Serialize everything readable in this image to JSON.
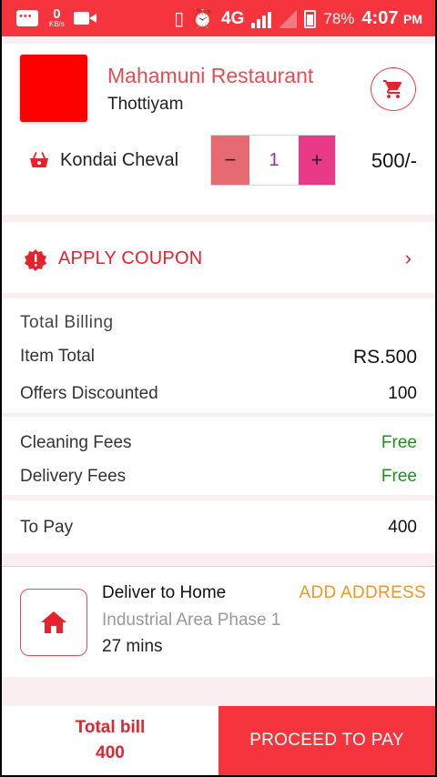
{
  "status_bar": {
    "net_speed_value": "0",
    "net_speed_unit": "KB/s",
    "network_type": "4G",
    "battery_percent": "78%",
    "time": "4:07",
    "time_suffix": "PM"
  },
  "restaurant": {
    "name": "Mahamuni Restaurant",
    "location": "Thottiyam"
  },
  "item": {
    "name": "Kondai Cheval",
    "minus_label": "−",
    "quantity": "1",
    "plus_label": "+",
    "price": "500/-"
  },
  "coupon": {
    "label": "APPLY COUPON",
    "chevron": "›"
  },
  "billing": {
    "title": "Total Billing",
    "item_total_label": "Item Total",
    "item_total_value": "RS.500",
    "offers_label": "Offers Discounted",
    "offers_value": "100"
  },
  "fees": {
    "cleaning_label": "Cleaning Fees",
    "cleaning_value": "Free",
    "delivery_label": "Delivery Fees",
    "delivery_value": "Free"
  },
  "to_pay": {
    "label": "To Pay",
    "value": "400"
  },
  "delivery": {
    "title": "Deliver to Home",
    "address": "Industrial Area Phase 1",
    "eta": "27 mins",
    "add_address_label": "ADD ADDRESS"
  },
  "footer": {
    "total_label": "Total bill",
    "total_value": "400",
    "pay_label": "PROCEED TO PAY"
  },
  "colors": {
    "brand_red": "#f5343d",
    "free_green": "#1e8e1e",
    "accent_orange": "#f0962a"
  }
}
